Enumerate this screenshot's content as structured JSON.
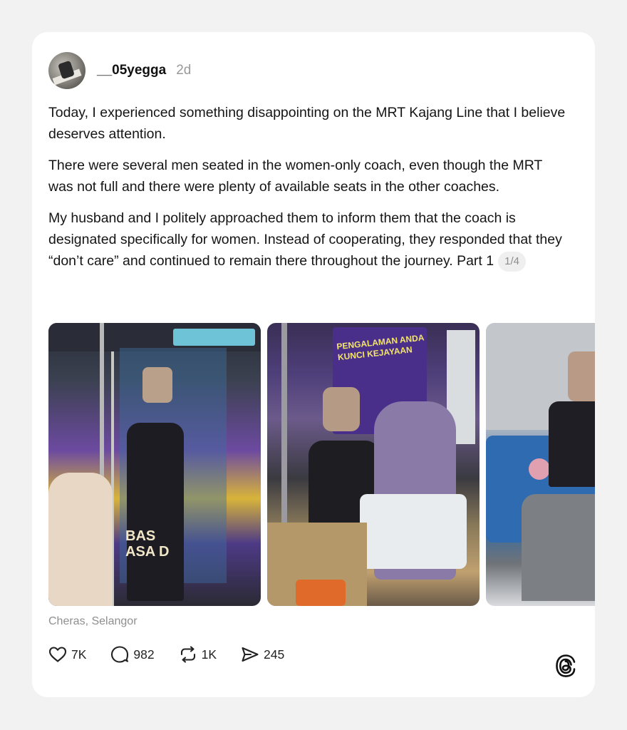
{
  "post": {
    "username": "__05yegga",
    "time": "2d",
    "paragraphs": [
      "Today, I experienced something disappointing on the MRT Kajang Line that I believe deserves attention.",
      "There were several men seated in the women-only coach, even though the MRT was not full and there were plenty of available seats in the other coaches.",
      "My husband and I politely approached them to inform them that the coach is designated specifically for women. Instead of cooperating, they responded that they “don’t care” and continued to remain there throughout the journey. Part 1"
    ],
    "page_badge": "1/4",
    "location": "Cheras, Selangor",
    "photo_signs": {
      "photo1_sign": "BAS\nASA D",
      "photo2_poster": "PENGALAMAN ANDA\nKUNCI KEJAYAAN"
    }
  },
  "actions": {
    "likes": "7K",
    "comments": "982",
    "reposts": "1K",
    "shares": "245"
  },
  "icons": [
    "heart-icon",
    "comment-icon",
    "repost-icon",
    "share-icon",
    "threads-logo-icon"
  ],
  "colors": {
    "background": "#f2f2f2",
    "card": "#ffffff",
    "muted": "#8f8f8f"
  }
}
